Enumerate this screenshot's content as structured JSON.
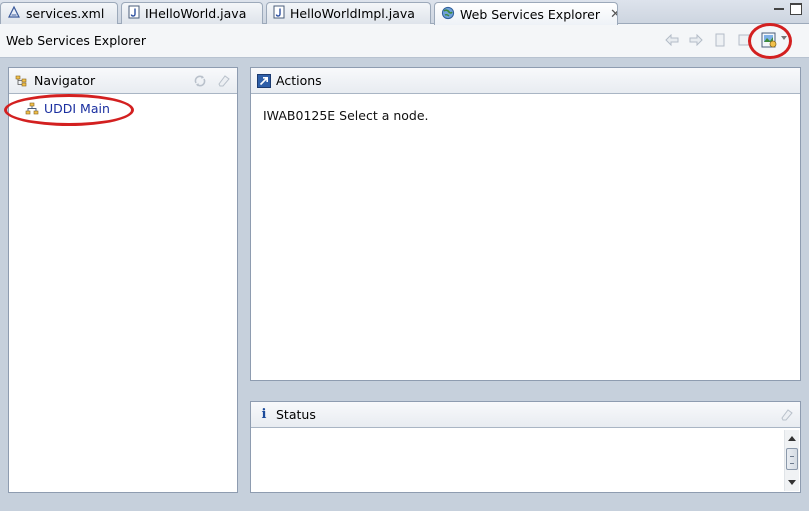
{
  "tabs": [
    {
      "label": "services.xml",
      "icon": "xml-file-icon",
      "active": false
    },
    {
      "label": "IHelloWorld.java",
      "icon": "java-file-icon",
      "active": false
    },
    {
      "label": "HelloWorldImpl.java",
      "icon": "java-file-icon",
      "active": false
    },
    {
      "label": "Web Services Explorer",
      "icon": "globe-icon",
      "active": true
    }
  ],
  "close_glyph": "✕",
  "header": {
    "title": "Web Services Explorer"
  },
  "navigator": {
    "title": "Navigator",
    "items": [
      {
        "label": "UDDI Main",
        "icon": "uddi-tree-icon"
      }
    ]
  },
  "actions": {
    "title": "Actions",
    "message": "IWAB0125E Select a node."
  },
  "status": {
    "title": "Status",
    "info_glyph": "i"
  },
  "colors": {
    "highlight": "#d32020",
    "link": "#1a2fa0"
  }
}
